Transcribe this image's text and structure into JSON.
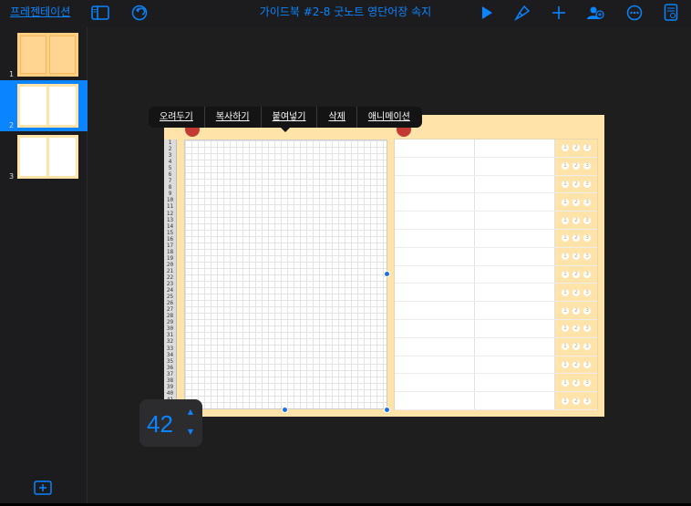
{
  "toolbar": {
    "back_label": "프레젠테이션",
    "title": "가이드북 #2-8 굿노트 영단어장 속지",
    "icons": [
      "sidebar-icon",
      "undo-icon",
      "play-icon",
      "format-brush-icon",
      "add-icon",
      "collaborate-icon",
      "more-icon",
      "document-icon"
    ]
  },
  "sidebar": {
    "slides": [
      {
        "number": "1",
        "selected": false
      },
      {
        "number": "2",
        "selected": true
      },
      {
        "number": "3",
        "selected": false
      }
    ],
    "add_icon": "add-slide-icon"
  },
  "context_menu": {
    "items": [
      "오려두기",
      "복사하기",
      "붙여넣기",
      "삭제",
      "애니메이션"
    ]
  },
  "stepper": {
    "value": "42"
  },
  "ruler_numbers": [
    "1",
    "2",
    "3",
    "4",
    "5",
    "6",
    "7",
    "8",
    "9",
    "10",
    "11",
    "12",
    "13",
    "14",
    "15",
    "16",
    "17",
    "18",
    "19",
    "20",
    "21",
    "22",
    "23",
    "24",
    "25",
    "26",
    "27",
    "28",
    "29",
    "30",
    "31",
    "32",
    "33",
    "34",
    "35",
    "36",
    "37",
    "38",
    "39",
    "40",
    "41",
    "42"
  ],
  "colors": {
    "accent": "#0a84ff",
    "page_tan": "#ffe3a8",
    "marker_red": "#c23a32",
    "selection_handle": "#1e6fe0"
  }
}
